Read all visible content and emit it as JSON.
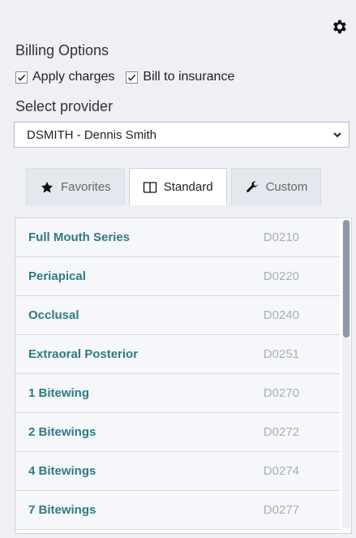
{
  "header": {
    "settings_icon": "gear-icon"
  },
  "billing": {
    "title": "Billing Options",
    "apply_charges": {
      "label": "Apply charges",
      "checked": true
    },
    "bill_insurance": {
      "label": "Bill to insurance",
      "checked": true
    }
  },
  "provider": {
    "label": "Select provider",
    "value": "DSMITH - Dennis Smith"
  },
  "tabs": [
    {
      "label": "Favorites",
      "icon": "star-icon",
      "active": false
    },
    {
      "label": "Standard",
      "icon": "book-icon",
      "active": true
    },
    {
      "label": "Custom",
      "icon": "wrench-icon",
      "active": false
    }
  ],
  "procedures": [
    {
      "name": "Full Mouth Series",
      "code": "D0210"
    },
    {
      "name": "Periapical",
      "code": "D0220"
    },
    {
      "name": "Occlusal",
      "code": "D0240"
    },
    {
      "name": "Extraoral Posterior",
      "code": "D0251"
    },
    {
      "name": "1 Bitewing",
      "code": "D0270"
    },
    {
      "name": "2 Bitewings",
      "code": "D0272"
    },
    {
      "name": "4 Bitewings",
      "code": "D0274"
    },
    {
      "name": "7 Bitewings",
      "code": "D0277"
    }
  ],
  "colors": {
    "accent": "#2e7a86",
    "code": "#a9aeb6",
    "background": "#eef0f6"
  }
}
